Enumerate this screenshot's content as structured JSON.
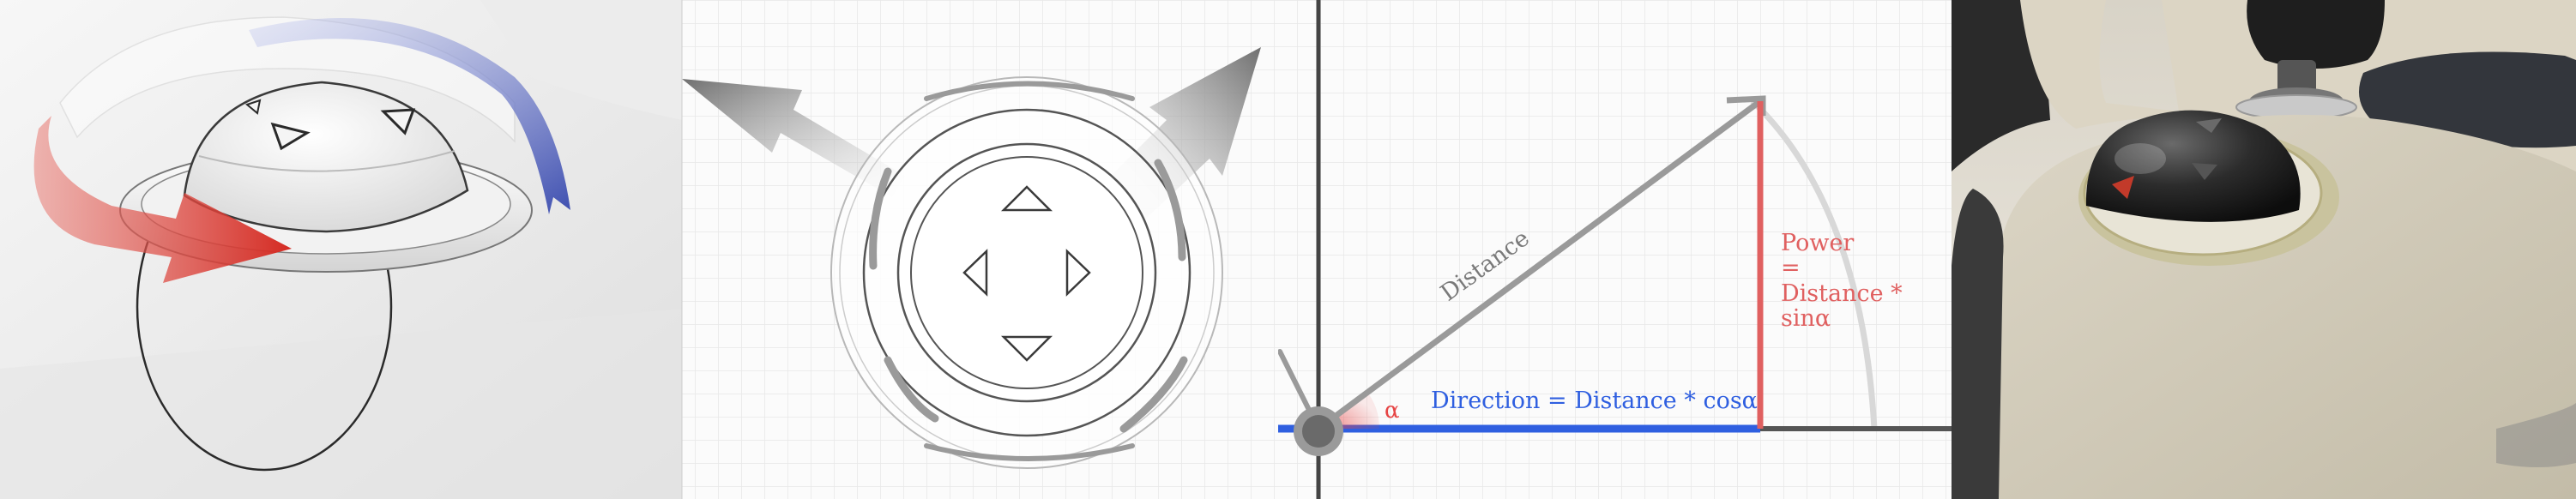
{
  "panels": [
    {
      "name": "render-3d-rotation"
    },
    {
      "name": "ui-control-top-view"
    },
    {
      "name": "vector-diagram"
    },
    {
      "name": "product-render"
    }
  ],
  "diagram": {
    "distance_label": "Distance",
    "alpha_label": "α",
    "direction_label": "Direction = Distance * cosα",
    "power_lines": [
      "Power",
      "=",
      "Distance *",
      "sinα"
    ]
  },
  "colors": {
    "direction_blue": "#2f5fe0",
    "power_red": "#e06060",
    "alpha_red": "#e64545",
    "rotation_red": "#d8322a",
    "rotation_blue": "#4a5ab8",
    "grid_line": "#e9e9e9",
    "axis_dark": "#444444"
  },
  "icons": [
    "up-arrow-icon",
    "down-arrow-icon",
    "left-arrow-icon",
    "right-arrow-icon"
  ]
}
